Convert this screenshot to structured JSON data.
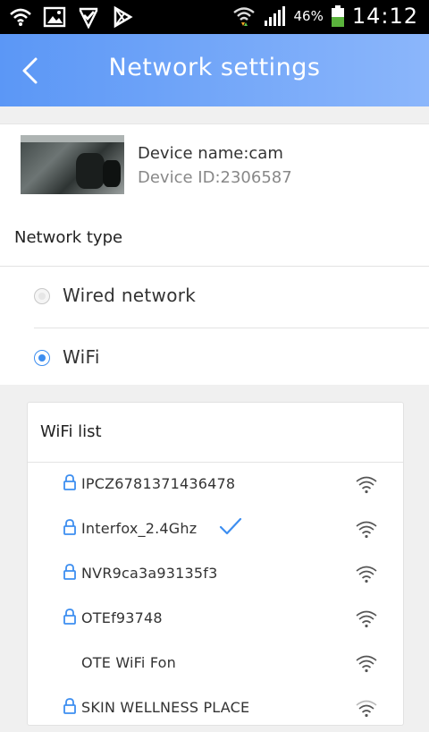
{
  "status_bar": {
    "icons_left": [
      "wifi-signal-icon",
      "gallery-icon",
      "check-shield-icon",
      "play-store-icon"
    ],
    "battery_percent": "46%",
    "time": "14:12"
  },
  "header": {
    "title": "Network settings",
    "back_icon": "chevron-left-icon",
    "gradient": [
      "#5b97f6",
      "#8bb6fb"
    ]
  },
  "device": {
    "name": "Device name:cam",
    "id": "Device ID:2306587"
  },
  "network_type": {
    "label": "Network type",
    "options": [
      {
        "label": "Wired network",
        "selected": false
      },
      {
        "label": "WiFi",
        "selected": true
      }
    ]
  },
  "wifi_list": {
    "title": "WiFi list",
    "networks": [
      {
        "ssid": "IPCZ6781371436478",
        "locked": true,
        "connected": false
      },
      {
        "ssid": "Interfox_2.4Ghz",
        "locked": true,
        "connected": true
      },
      {
        "ssid": "NVR9ca3a93135f3",
        "locked": true,
        "connected": false
      },
      {
        "ssid": "OTEf93748",
        "locked": true,
        "connected": false
      },
      {
        "ssid": "OTE WiFi Fon",
        "locked": false,
        "connected": false
      },
      {
        "ssid": "SKIN WELLNESS PLACE",
        "locked": true,
        "connected": false
      }
    ]
  },
  "colors": {
    "accent": "#3d8ef0",
    "background": "#f0f0f0"
  }
}
